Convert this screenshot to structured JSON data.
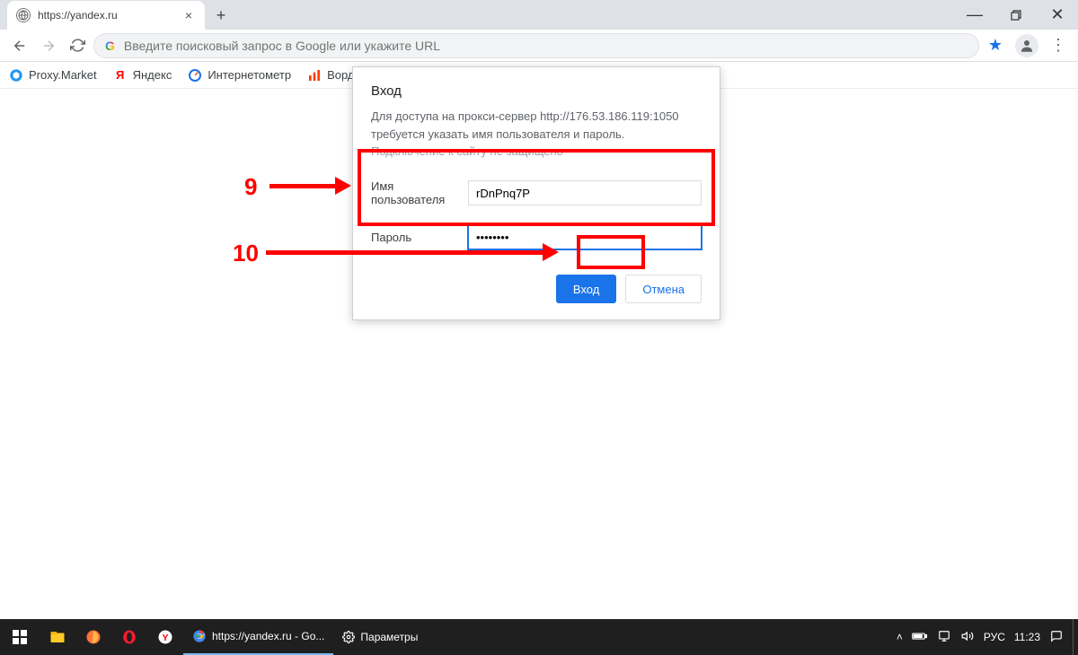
{
  "tab": {
    "title": "https://yandex.ru"
  },
  "omnibox": {
    "placeholder": "Введите поисковый запрос в Google или укажите URL"
  },
  "bookmarks": [
    {
      "label": "Proxy.Market"
    },
    {
      "label": "Яндекс"
    },
    {
      "label": "Интернетометр"
    },
    {
      "label": "Вордстат"
    }
  ],
  "dialog": {
    "title": "Вход",
    "message": "Для доступа на прокси-сервер http://176.53.186.119:1050 требуется указать имя пользователя и пароль.",
    "warning": "Подключение к сайту не защищено",
    "username_label": "Имя пользователя",
    "username_value": "rDnPnq7P",
    "password_label": "Пароль",
    "password_value": "••••••••",
    "submit": "Вход",
    "cancel": "Отмена"
  },
  "annotations": {
    "step9": "9",
    "step10": "10"
  },
  "taskbar": {
    "chrome_task": "https://yandex.ru - Go...",
    "settings_task": "Параметры",
    "lang": "РУС",
    "time": "11:23"
  },
  "colors": {
    "accent": "#1a73e8",
    "annotation": "#ff0000"
  }
}
